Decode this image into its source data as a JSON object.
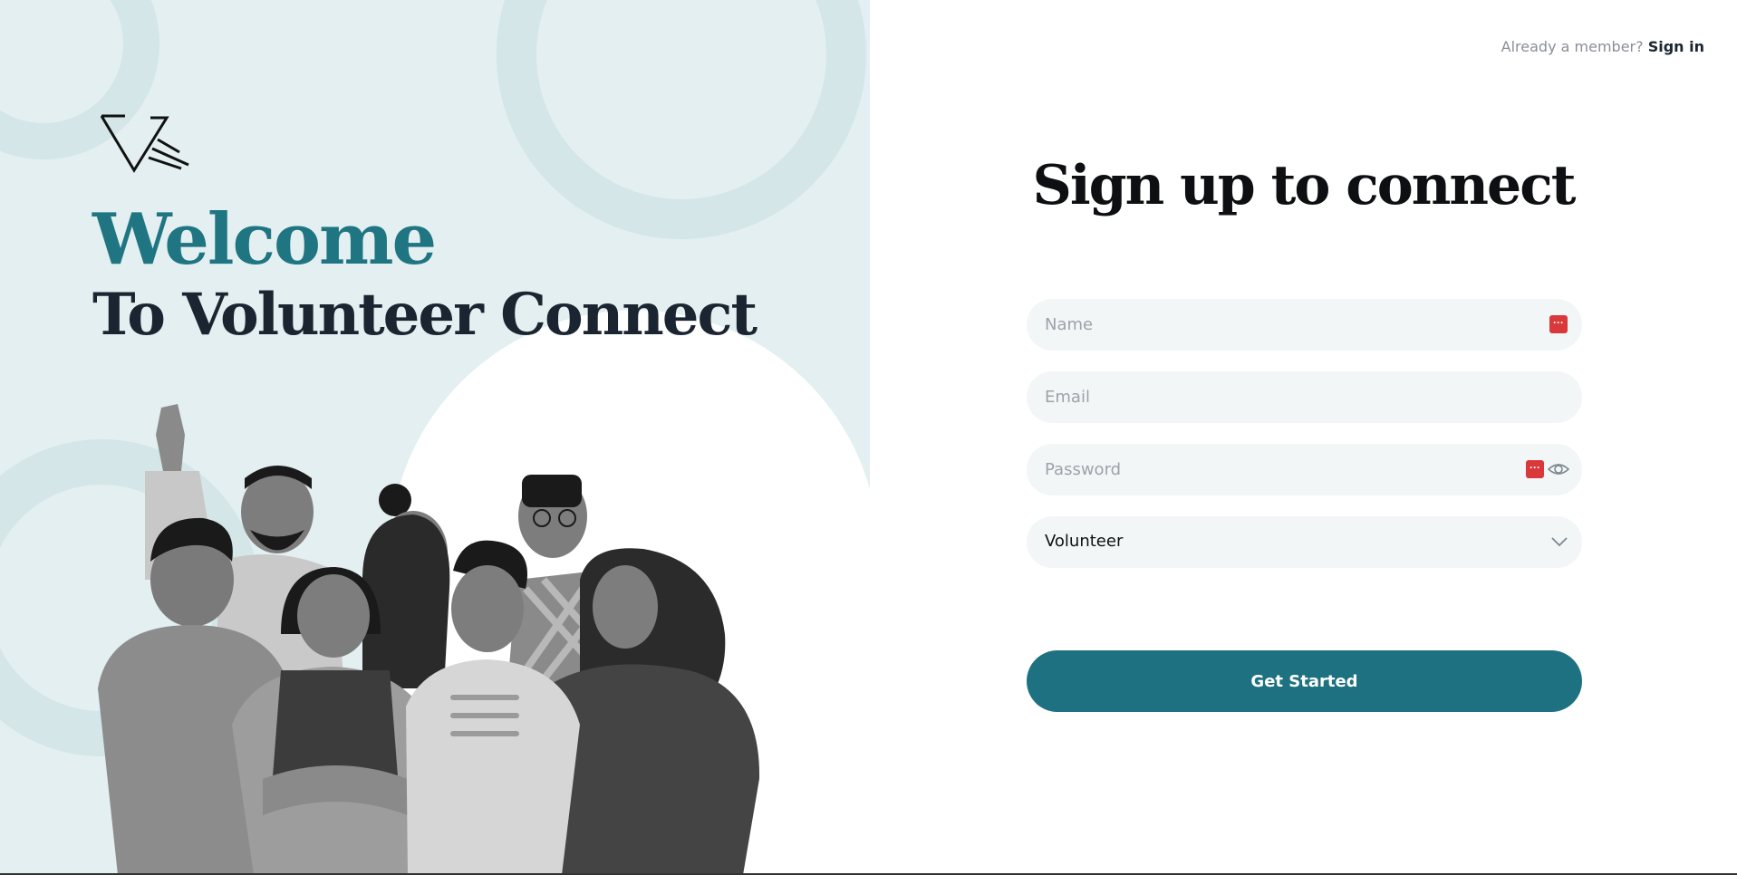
{
  "left": {
    "welcome": "Welcome",
    "subtitle": "To Volunteer Connect",
    "logo_icon": "vc-logo-icon",
    "illustration": "group-of-volunteers-illustration"
  },
  "header": {
    "member_text": "Already a member?",
    "signin_label": "Sign in"
  },
  "form": {
    "heading": "Sign up to connect",
    "name_placeholder": "Name",
    "email_placeholder": "Email",
    "password_placeholder": "Password",
    "role_value": "Volunteer",
    "submit_label": "Get Started"
  },
  "colors": {
    "accent": "#1d7180",
    "welcome": "#1f7682",
    "left_bg": "#e3eff0",
    "field_bg": "#f3f6f7"
  }
}
